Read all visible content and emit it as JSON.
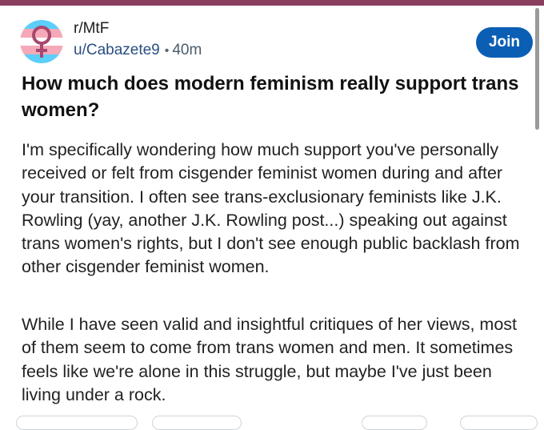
{
  "post": {
    "subreddit": "r/MtF",
    "author": "u/Cabazete9",
    "separator": "•",
    "age": "40m",
    "join_label": "Join",
    "title": "How much does modern feminism really support trans women?",
    "paragraphs": [
      "I'm specifically wondering how much support you've personally received or felt from cisgender feminist women during and after your transition. I often see trans-exclusionary feminists like J.K. Rowling (yay, another J.K. Rowling post...) speaking out against trans women's rights, but I don't see enough public backlash from other cisgender feminist women.",
      "While I have seen valid and insightful critiques of her views, most of them seem to come from trans women and men. It sometimes feels like we're alone in this struggle, but maybe I've just been living under a rock."
    ]
  },
  "icons": {
    "avatar": "trans-flag-venus-icon"
  },
  "colors": {
    "top_bar": "#8a3e5e",
    "join_button": "#0a5fb5",
    "author_link": "#2a4f82",
    "trans_blue": "#5bcefa",
    "trans_pink": "#f5a9b8",
    "venus_symbol": "#a8476f"
  }
}
